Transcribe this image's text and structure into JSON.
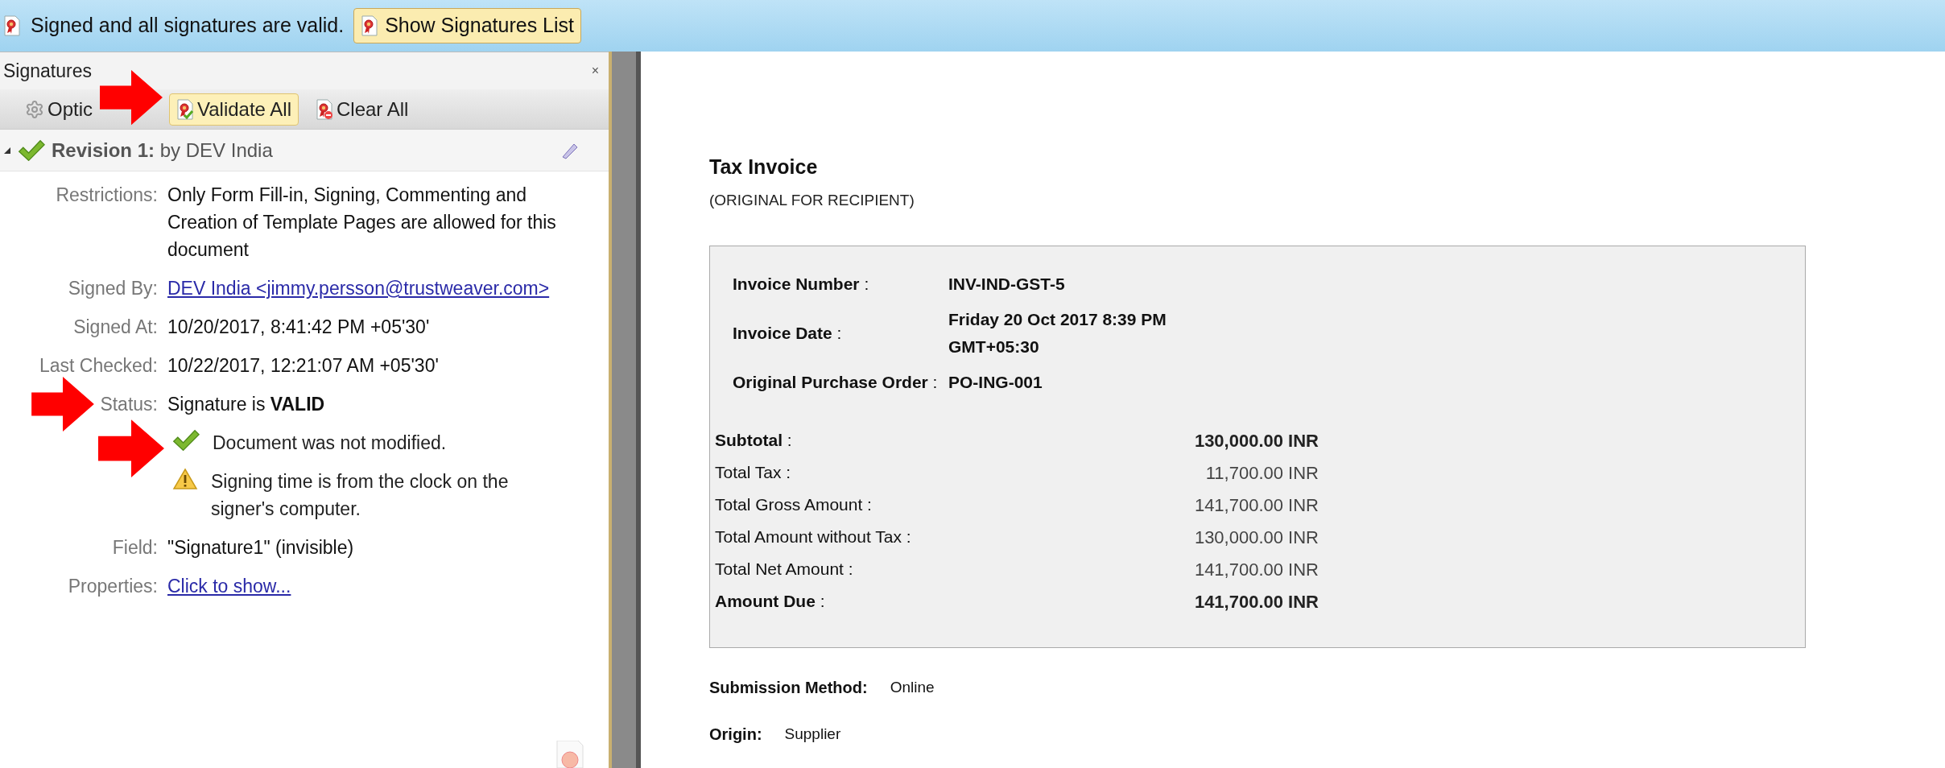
{
  "notification_bar": {
    "message": "Signed and all signatures are valid.",
    "button": "Show Signatures List"
  },
  "signatures_panel": {
    "title": "Signatures",
    "close": "×",
    "toolbar": [
      {
        "label": "Optic",
        "kind": "options",
        "selected": false
      },
      {
        "label": "Validate All",
        "kind": "validate",
        "selected": true
      },
      {
        "label": "Clear All",
        "kind": "clear",
        "selected": false
      }
    ],
    "revision": {
      "title": "Revision 1:",
      "by": "by DEV India",
      "expanded": true,
      "valid": true,
      "details": [
        {
          "label": "Restrictions:",
          "value": "Only Form Fill-in, Signing, Commenting and Creation of Template Pages are allowed for this document",
          "kind": "text"
        },
        {
          "label": "Signed By:",
          "value": "DEV India <jimmy.persson@trustweaver.com>",
          "kind": "link"
        },
        {
          "label": "Signed At:",
          "value": "10/20/2017, 8:41:42 PM +05'30'",
          "kind": "text"
        },
        {
          "label": "Last Checked:",
          "value": "10/22/2017, 12:21:07 AM +05'30'",
          "kind": "text"
        },
        {
          "label": "Status:",
          "value": "Signature is **VALID**",
          "kind": "text"
        },
        {
          "kind": "check",
          "value": "Document was not modified."
        },
        {
          "kind": "warning",
          "value": "Signing time is from the clock on the signer's computer."
        },
        {
          "label": "Field:",
          "value": "\"Signature1\" (invisible)",
          "kind": "text"
        },
        {
          "label": "Properties:",
          "value": "Click to show...",
          "kind": "link"
        }
      ]
    }
  },
  "document": {
    "title": "Tax Invoice",
    "subtitle": "(ORIGINAL FOR RECIPIENT)",
    "header_fields": [
      {
        "label": "**Invoice Number** :",
        "value": "INV-IND-GST-5"
      },
      {
        "label": "**Invoice Date** :",
        "value": "Friday 20 Oct 2017 8:39 PM GMT+05:30"
      },
      {
        "label": "**Original Purchase Order** :",
        "value": "PO-ING-001"
      }
    ],
    "totals": [
      {
        "label": "**Subtotal** :",
        "amount": "130,000.00 INR",
        "emphasis": true
      },
      {
        "label": "Total Tax :",
        "amount": "11,700.00 INR",
        "emphasis": false
      },
      {
        "label": "Total Gross Amount :",
        "amount": "141,700.00 INR",
        "emphasis": false
      },
      {
        "label": "Total Amount without Tax :",
        "amount": "130,000.00 INR",
        "emphasis": false
      },
      {
        "label": "Total Net Amount :",
        "amount": "141,700.00 INR",
        "emphasis": false
      },
      {
        "label": "**Amount Due** :",
        "amount": "141,700.00 INR",
        "emphasis": true
      }
    ],
    "footer_fields": [
      {
        "label": "Submission Method:",
        "value": "Online"
      },
      {
        "label": "Origin:",
        "value": "Supplier"
      }
    ]
  }
}
